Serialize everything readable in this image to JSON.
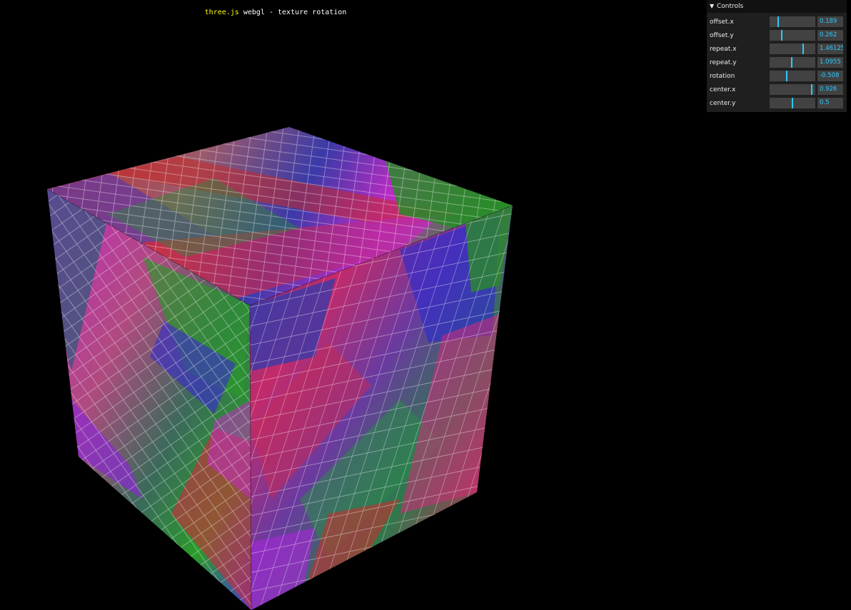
{
  "header": {
    "link_text": "three.js",
    "rest_text": " webgl - texture rotation"
  },
  "gui": {
    "title": "Controls",
    "chevron_icon": "chevron-down-icon",
    "controls": [
      {
        "label": "offset.x",
        "value": "0.189",
        "fraction": 0.189
      },
      {
        "label": "offset.y",
        "value": "0.262",
        "fraction": 0.262
      },
      {
        "label": "repeat.x",
        "value": "1.46125",
        "fraction": 0.73
      },
      {
        "label": "repeat.y",
        "value": "1.0955",
        "fraction": 0.48
      },
      {
        "label": "rotation",
        "value": "-0.508",
        "fraction": 0.38
      },
      {
        "label": "center.x",
        "value": "0.926",
        "fraction": 0.926
      },
      {
        "label": "center.y",
        "value": "0.5",
        "fraction": 0.5
      }
    ],
    "accent_color": "#2cc9ff"
  },
  "scene": {
    "object": "textured-cube",
    "texture_colors": [
      "#d42a2a",
      "#2a9a2a",
      "#2a2ad4",
      "#c42ac4"
    ]
  }
}
